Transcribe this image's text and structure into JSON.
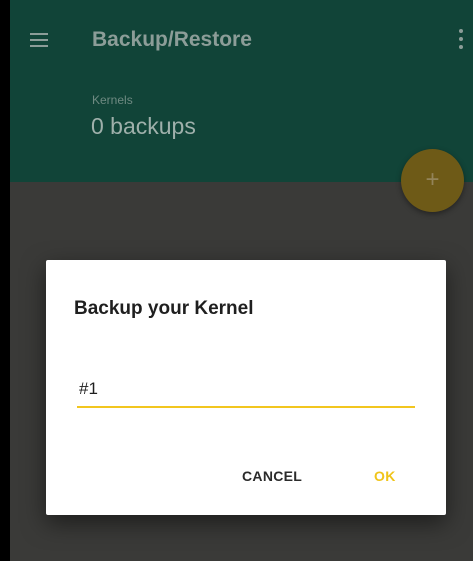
{
  "appbar": {
    "title": "Backup/Restore",
    "menu_icon": "hamburger-menu-icon",
    "overflow_icon": "more-vert-icon"
  },
  "section": {
    "label": "Kernels",
    "count": "0 backups"
  },
  "fab": {
    "icon": "plus-icon",
    "glyph": "+"
  },
  "dialog": {
    "title": "Backup your Kernel",
    "input_value": "#1",
    "cancel_label": "CANCEL",
    "ok_label": "OK"
  },
  "colors": {
    "appbar": "#114438",
    "accent": "#f0c419",
    "scrim_content": "#3a3a38"
  }
}
